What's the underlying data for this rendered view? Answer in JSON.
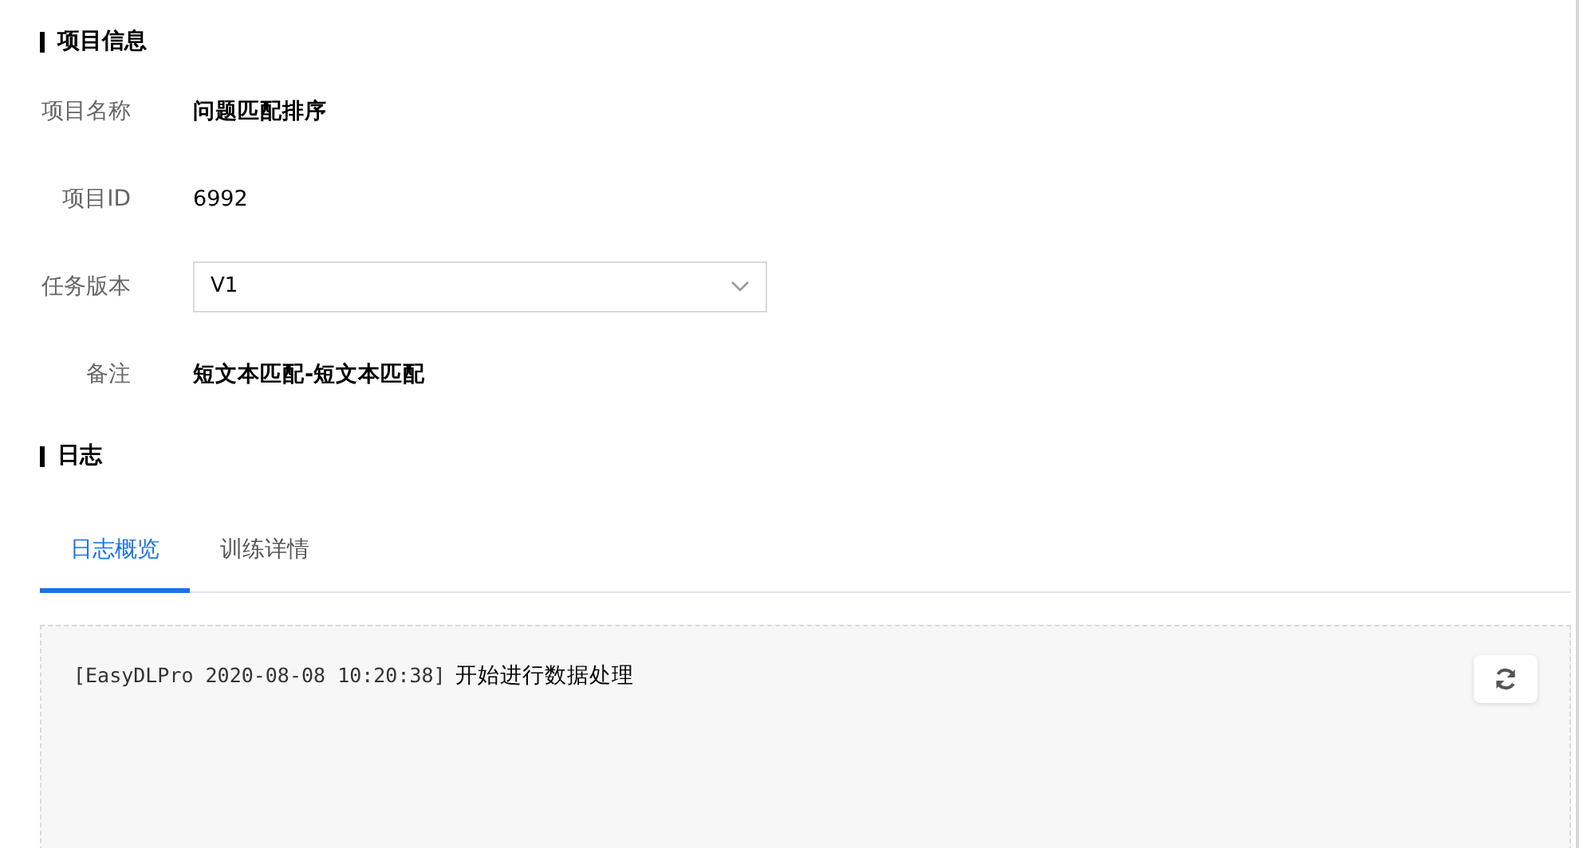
{
  "project_section": {
    "title": "项目信息",
    "fields": [
      {
        "kind": "text",
        "label": "项目名称",
        "value": "问题匹配排序",
        "emphasis": true
      },
      {
        "kind": "text",
        "label": "项目ID",
        "value": "6992",
        "emphasis": false
      },
      {
        "kind": "select",
        "label": "任务版本",
        "value": "V1"
      },
      {
        "kind": "text",
        "label": "备注",
        "value": "短文本匹配-短文本匹配",
        "emphasis": true
      }
    ]
  },
  "log_section": {
    "title": "日志",
    "tabs": [
      {
        "label": "日志概览",
        "selected": true
      },
      {
        "label": "训练详情",
        "selected": false
      }
    ],
    "log_lines": [
      {
        "prefix": "[EasyDLPro 2020-08-08 10:20:38]",
        "message": "开始进行数据处理"
      }
    ]
  }
}
